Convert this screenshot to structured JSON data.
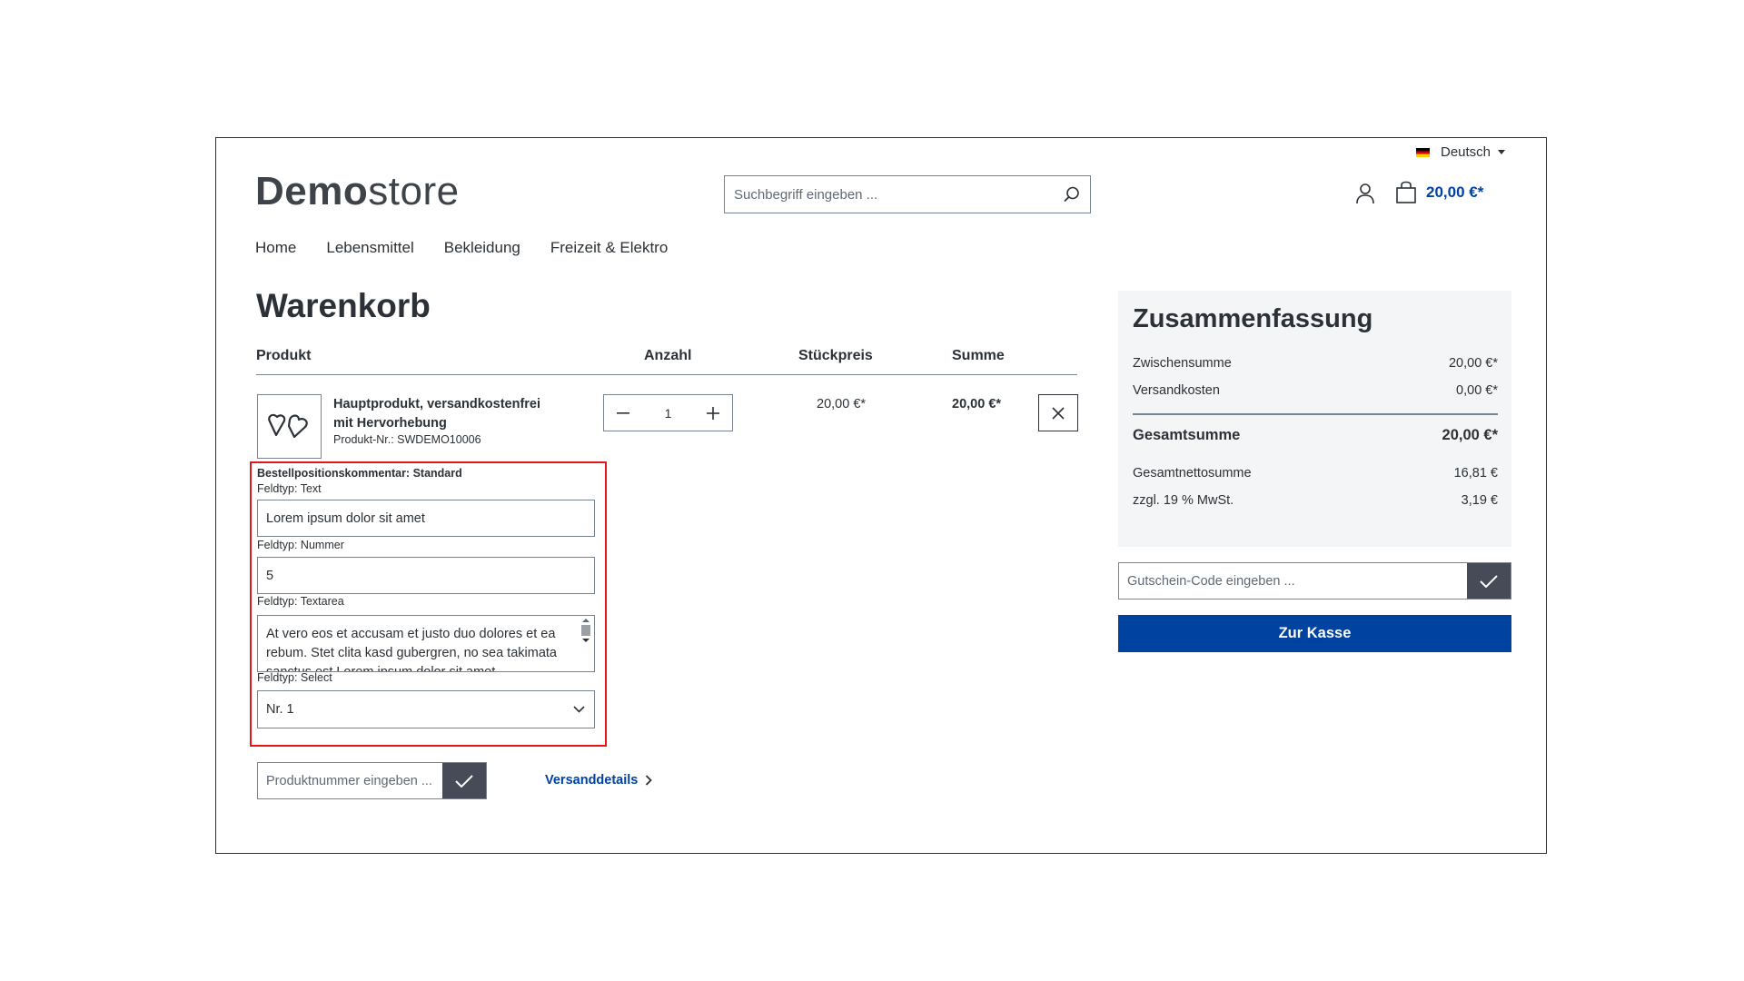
{
  "header": {
    "language": "Deutsch",
    "logo_bold": "Demo",
    "logo_light": "store",
    "search_placeholder": "Suchbegriff eingeben ...",
    "cart_total": "20,00 €*"
  },
  "nav": [
    "Home",
    "Lebensmittel",
    "Bekleidung",
    "Freizeit & Elektro"
  ],
  "page_title": "Warenkorb",
  "table": {
    "headers": {
      "product": "Produkt",
      "quantity": "Anzahl",
      "unit_price": "Stückpreis",
      "total": "Summe"
    }
  },
  "item": {
    "name": "Hauptprodukt, versandkostenfrei mit Hervorhebung",
    "number": "Produkt-Nr.: SWDEMO10006",
    "quantity": "1",
    "unit_price": "20,00 €*",
    "total": "20,00 €*",
    "comment": {
      "heading": "Bestellpositionskommentar: Standard",
      "text_label": "Feldtyp: Text",
      "text_value": "Lorem ipsum dolor sit amet",
      "number_label": "Feldtyp: Nummer",
      "number_value": "5",
      "textarea_label": "Feldtyp: Textarea",
      "textarea_value": "At vero eos et accusam et justo duo dolores et ea rebum. Stet clita kasd gubergren, no sea takimata sanctus est Lorem ipsum dolor sit amet.",
      "select_label": "Feldtyp: Select",
      "select_value": "Nr. 1"
    }
  },
  "product_number_placeholder": "Produktnummer eingeben ...",
  "shipping_link": "Versanddetails",
  "summary": {
    "title": "Zusammenfassung",
    "subtotal_label": "Zwischensumme",
    "subtotal": "20,00 €*",
    "shipping_label": "Versandkosten",
    "shipping": "0,00 €*",
    "grand_total_label": "Gesamtsumme",
    "grand_total": "20,00 €*",
    "net_label": "Gesamtnettosumme",
    "net": "16,81 €",
    "vat_label": "zzgl. 19 % MwSt.",
    "vat": "3,19 €"
  },
  "voucher_placeholder": "Gutschein-Code eingeben ...",
  "checkout_label": "Zur Kasse",
  "colors": {
    "primary": "#0042a0",
    "highlight": "#e3161b",
    "dark_button": "#474a57"
  }
}
